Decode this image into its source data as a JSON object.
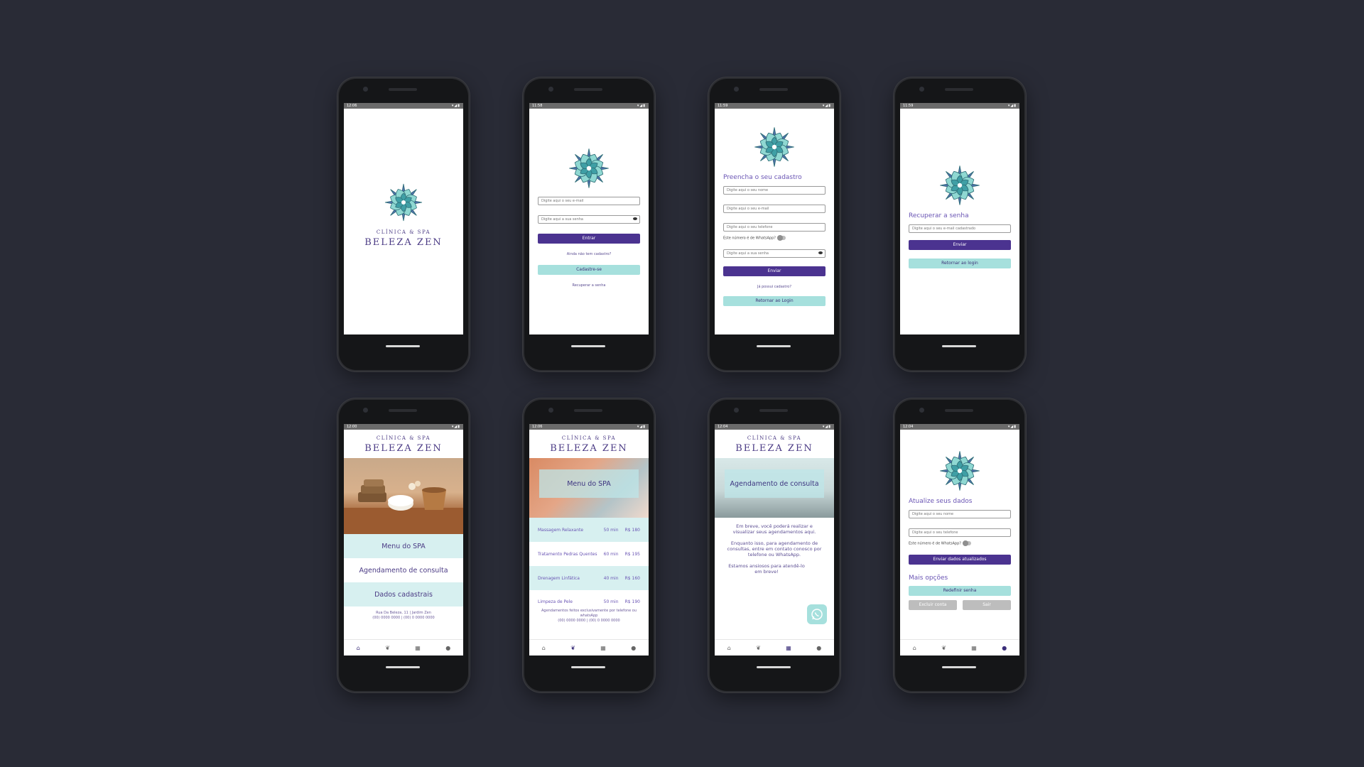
{
  "status": {
    "s1": "12:06",
    "s2": "11:58",
    "s3": "11:59",
    "s4": "11:59",
    "s5": "12:00",
    "s6": "12:06",
    "s7": "12:04",
    "s8": "12:04"
  },
  "brand": {
    "line1": "CLÍNICA & SPA",
    "line2": "BELEZA ZEN"
  },
  "login": {
    "email_ph": "Digite aqui o seu e-mail",
    "pass_ph": "Digite aqui a sua senha",
    "enter": "Entrar",
    "no_account": "Ainda não tem cadastro?",
    "signup": "Cadastre-se",
    "recover": "Recuperar a senha"
  },
  "register": {
    "title": "Preencha o seu cadastro",
    "name_ph": "Digite aqui o seu nome",
    "email_ph": "Digite aqui o seu e-mail",
    "phone_ph": "Digite aqui o seu telefone",
    "whatsapp": "Este número é de WhatsApp?",
    "pass_ph": "Digite aqui a sua senha",
    "send": "Enviar",
    "has_account": "Já possui cadastro?",
    "back": "Retornar ao Login"
  },
  "recover": {
    "title": "Recuperar a senha",
    "email_ph": "Digite aqui o seu e-mail cadastrado",
    "send": "Enviar",
    "back": "Retornar ao login"
  },
  "home": {
    "items": [
      "Menu do SPA",
      "Agendamento de consulta",
      "Dados cadastrais"
    ],
    "address": "Rua Da Beleza, 11 | Jardim Zen",
    "phones": "(00) 0000 0000 | (00) 0 0000 0000"
  },
  "spa": {
    "banner": "Menu do SPA",
    "rows": [
      {
        "name": "Massagem Relaxante",
        "time": "50 min",
        "price": "R$ 180"
      },
      {
        "name": "Tratamento Pedras Quentes",
        "time": "60 min",
        "price": "R$ 195"
      },
      {
        "name": "Drenagem Linfática",
        "time": "40 min",
        "price": "R$ 160"
      },
      {
        "name": "Limpeza de Pele",
        "time": "50 min",
        "price": "R$ 190"
      }
    ],
    "note1": "Agendamentos feitos exclusivamente por telefone ou",
    "note2": "whatsApp",
    "phones": "(00) 0000 0000 | (00) 0 0000 0000"
  },
  "schedule": {
    "banner": "Agendamento de consulta",
    "p1": "Em breve, você poderá realizar e visualizar seus agendamentos aqui.",
    "p2": "Enquanto isso, para agendamento de consultas, entre em contato conosco por telefone ou WhatsApp.",
    "p3": "Estamos ansiosos para atendê-lo em breve!"
  },
  "profile": {
    "title": "Atualize seus dados",
    "name_ph": "Digite aqui o seu nome",
    "phone_ph": "Digite aqui o seu telefone",
    "whatsapp": "Este número é de WhatsApp?",
    "update": "Enviar dados atualizados",
    "more": "Mais opções",
    "reset": "Redefinir senha",
    "delete": "Excluir conta",
    "exit": "Sair"
  },
  "tabs": {
    "home": "⌂",
    "spa": "❦",
    "calendar": "▦",
    "user": "●"
  },
  "colors": {
    "purple": "#4b3390",
    "teal": "#a6e0dd",
    "background": "#292b36"
  }
}
